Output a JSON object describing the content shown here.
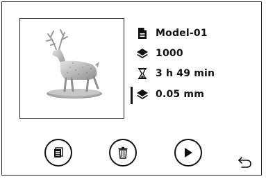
{
  "file": {
    "name": "Model-01",
    "layers": "1000",
    "print_time": "3 h 49 min",
    "layer_height": "0.05 mm"
  },
  "icons": {
    "name": "document-icon",
    "layers": "layers-icon",
    "time": "hourglass-icon",
    "layer_height": "layer-height-icon",
    "files": "file-list-icon",
    "delete": "trash-icon",
    "play": "play-icon",
    "back": "back-arrow-icon"
  },
  "colors": {
    "foreground": "#111111",
    "background": "#ffffff"
  }
}
